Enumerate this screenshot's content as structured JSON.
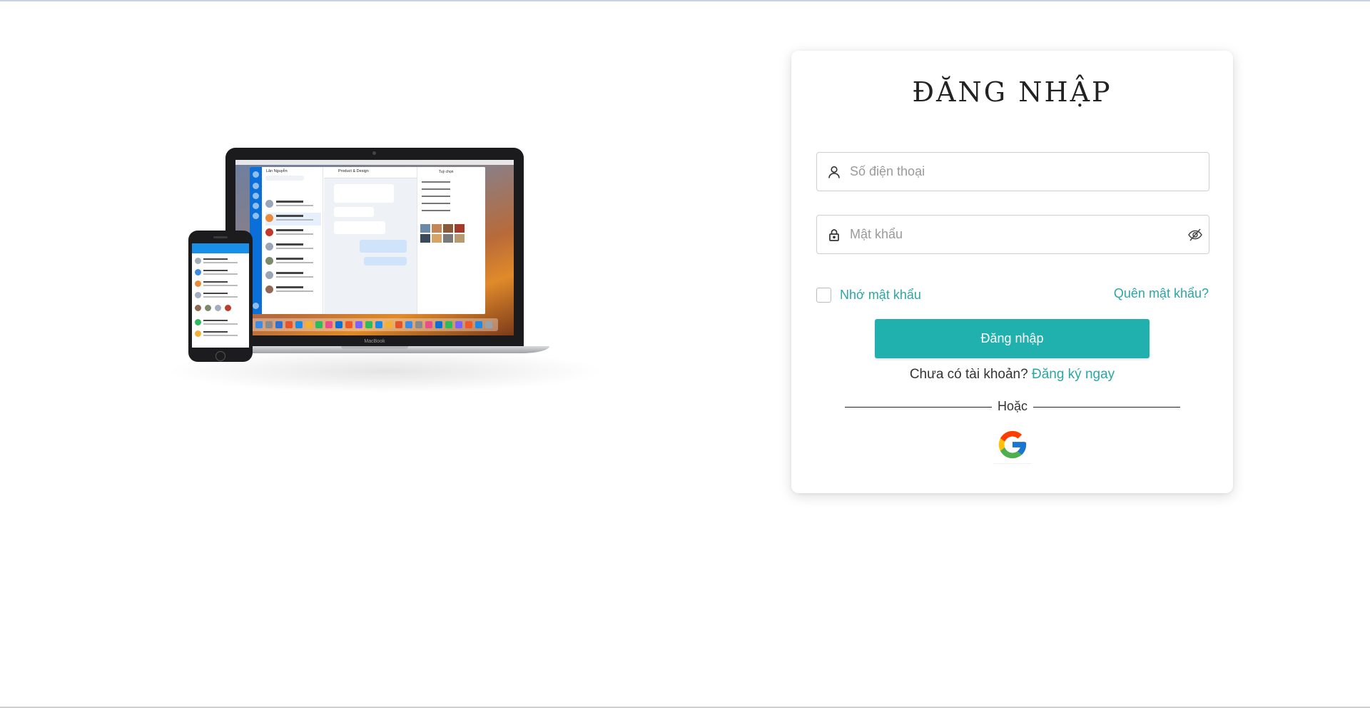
{
  "login": {
    "title": "ĐĂNG NHẬP",
    "phone_placeholder": "Số điện thoại",
    "password_placeholder": "Mật khẩu",
    "remember_label": "Nhớ mật khẩu",
    "forgot_label": "Quên mật khẩu?",
    "submit_label": "Đăng nhập",
    "signup_prompt": "Chưa có tài khoản?",
    "signup_link": "Đăng ký ngay",
    "divider_text": "Hoặc"
  },
  "icons": {
    "phone_field": "user-icon",
    "password_field": "lock-icon",
    "toggle_password": "eye-off-icon",
    "social_login": "google-icon"
  },
  "hero": {
    "laptop_brand": "MacBook",
    "app_list_title": "Lân Nguyễn",
    "chat_title": "Product & Design",
    "side_title": "Tuỳ chọn"
  },
  "colors": {
    "accent": "#20b0ad",
    "link": "#2aa7a4",
    "card_bg": "#ffffff",
    "page_bg": "#ffffff"
  }
}
